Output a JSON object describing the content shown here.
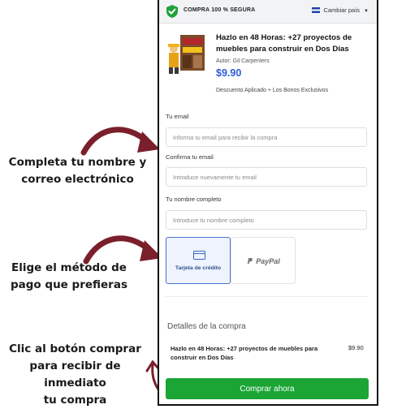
{
  "annotations": {
    "step1": [
      "Completa tu nombre y",
      "correo electrónico"
    ],
    "step2": [
      "Elige el método de",
      "pago que prefieras"
    ],
    "step3": [
      "Clic al botón comprar",
      "para recibir de inmediato",
      "tu compra"
    ]
  },
  "topbar": {
    "secure_label": "COMPRA 100 % SEGURA",
    "country_label": "Cambiar país"
  },
  "product": {
    "title": "Hazlo en 48 Horas: +27 proyectos de muebles para construir en Dos Días",
    "author": "Autor: Gil Carpenters",
    "price": "$9.90",
    "description": "Descuento Aplicado + Los Bonos Exclusivos"
  },
  "form": {
    "email_label": "Tu email",
    "email_placeholder": "Informa tu email para recibir la compra",
    "confirm_label": "Confirma tu email",
    "confirm_placeholder": "Introduce nuevamente tu email",
    "name_label": "Tu nombre completo",
    "name_placeholder": "Introduce tu nombre completo"
  },
  "payment": {
    "card_label": "Tarjeta de crédito",
    "paypal_label": "PayPal"
  },
  "summary": {
    "title": "Detalles de la compra",
    "item_name": "Hazlo en 48 Horas: +27 proyectos de muebles para construir en Dos Días",
    "item_price": "$9.90"
  },
  "buy_button": "Comprar ahora",
  "colors": {
    "accent": "#2d5bd7",
    "buy": "#1aa535",
    "arrow": "#7a1f2b",
    "secure": "#20a13a"
  }
}
